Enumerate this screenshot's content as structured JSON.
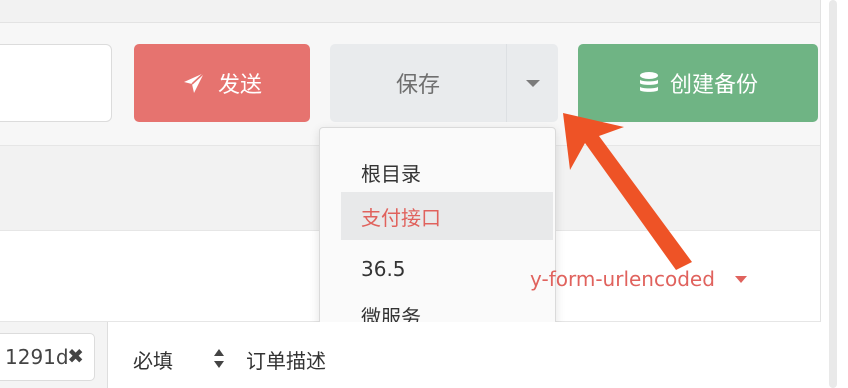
{
  "toolbar": {
    "send_label": "发送",
    "save_label": "保存",
    "backup_label": "创建备份"
  },
  "save_menu": {
    "items": [
      {
        "label": "根目录",
        "active": false
      },
      {
        "label": "支付接口",
        "active": true
      },
      {
        "label": "36.5",
        "active": false
      },
      {
        "label": "微服务",
        "active": false
      }
    ]
  },
  "body": {
    "content_type": "y-form-urlencoded"
  },
  "params": {
    "value_fragment": "1291d",
    "required_label": "必填",
    "description_label": "订单描述"
  },
  "colors": {
    "send": "#e6736f",
    "save": "#e9ebed",
    "backup": "#6fb484",
    "accent_text": "#e0625d",
    "annotation_arrow": "#ee5326"
  },
  "icons": {
    "send": "paper-plane-icon",
    "backup": "database-icon",
    "caret": "caret-down-icon",
    "clear": "close-icon"
  }
}
